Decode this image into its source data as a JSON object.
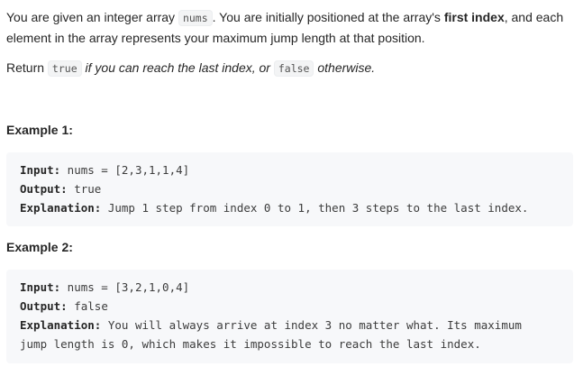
{
  "intro": {
    "t1": "You are given an integer array ",
    "code_nums": "nums",
    "t2": ". You are initially positioned at the array's ",
    "bold_first_index": "first index",
    "t3": ", and each element in the array represents your maximum jump length at that position."
  },
  "return_line": {
    "t1": "Return ",
    "code_true": "true",
    "t2": " if you can reach the last index, or ",
    "code_false": "false",
    "t3": " otherwise."
  },
  "examples": [
    {
      "title": "Example 1:",
      "input_label": "Input:",
      "input_value": " nums = [2,3,1,1,4]",
      "output_label": "Output:",
      "output_value": " true",
      "explanation_label": "Explanation:",
      "explanation_value": " Jump 1 step from index 0 to 1, then 3 steps to the last index."
    },
    {
      "title": "Example 2:",
      "input_label": "Input:",
      "input_value": " nums = [3,2,1,0,4]",
      "output_label": "Output:",
      "output_value": " false",
      "explanation_label": "Explanation:",
      "explanation_value": " You will always arrive at index 3 no matter what. Its maximum jump length is 0, which makes it impossible to reach the last index."
    }
  ]
}
